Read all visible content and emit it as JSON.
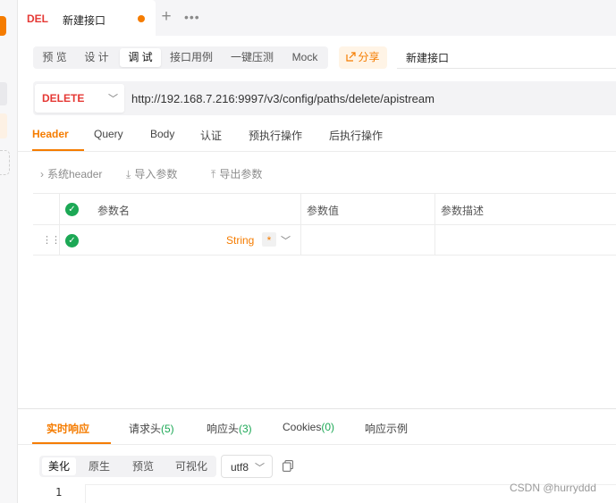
{
  "tab": {
    "method": "DEL",
    "title": "新建接口"
  },
  "mode_buttons": [
    {
      "label": "预 览"
    },
    {
      "label": "设 计"
    },
    {
      "label": "调 试"
    },
    {
      "label": "接口用例"
    },
    {
      "label": "一键压测"
    },
    {
      "label": "Mock"
    }
  ],
  "share_label": "分享",
  "api_name": "新建接口",
  "request": {
    "method": "DELETE",
    "url": "http://192.168.7.216:9997/v3/config/paths/delete/apistream"
  },
  "request_tabs": [
    {
      "label": "Header"
    },
    {
      "label": "Query"
    },
    {
      "label": "Body"
    },
    {
      "label": "认证"
    },
    {
      "label": "预执行操作"
    },
    {
      "label": "后执行操作"
    }
  ],
  "sub_toolbar": {
    "system_header": "系统header",
    "import": "导入参数",
    "export": "导出参数"
  },
  "param_table": {
    "columns": [
      "参数名",
      "参数值",
      "参数描述"
    ],
    "row": {
      "type": "String",
      "required_mark": "*"
    }
  },
  "response_tabs": [
    {
      "label": "实时响应",
      "count": ""
    },
    {
      "label": "请求头",
      "count": "(5)"
    },
    {
      "label": "响应头",
      "count": "(3)"
    },
    {
      "label": "Cookies",
      "count": "(0)"
    },
    {
      "label": "响应示例",
      "count": ""
    }
  ],
  "format_buttons": [
    {
      "label": "美化"
    },
    {
      "label": "原生"
    },
    {
      "label": "预览"
    },
    {
      "label": "可视化"
    }
  ],
  "encoding": "utf8",
  "line_number": "1",
  "watermark": "CSDN @hurryddd",
  "colors": {
    "accent": "#f57c00",
    "method": "#e53935",
    "success": "#1ca855"
  }
}
